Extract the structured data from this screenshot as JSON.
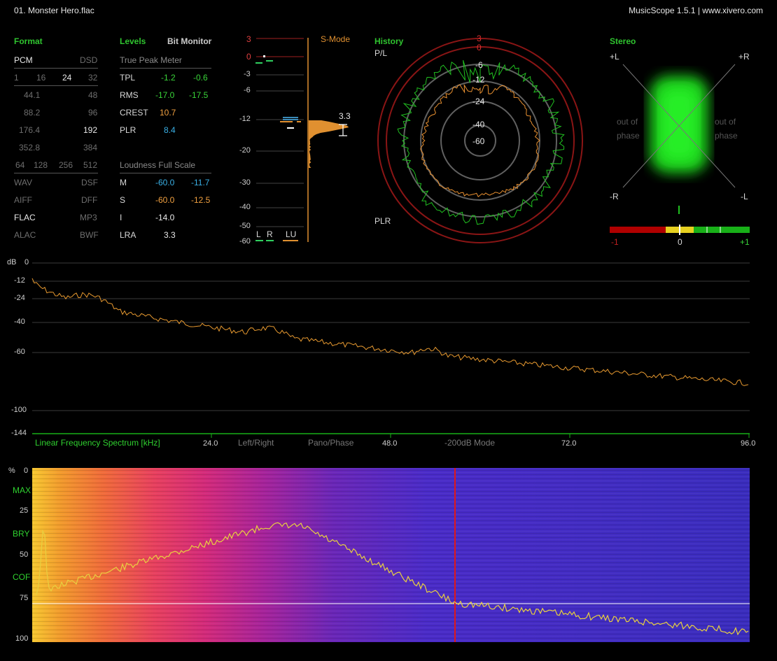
{
  "header": {
    "file": "01. Monster Hero.flac",
    "app": "MusicScope 1.5.1 | www.xivero.com"
  },
  "format": {
    "title": "Format",
    "rows": [
      {
        "l": "PCM",
        "r": "DSD"
      },
      {
        "cells": [
          "1",
          "16",
          "24",
          "32"
        ]
      },
      {
        "l": "44.1",
        "r": "48"
      },
      {
        "l": "88.2",
        "r": "96"
      },
      {
        "l": "176.4",
        "r": "192"
      },
      {
        "l": "352.8",
        "r": "384"
      },
      {
        "cells": [
          "64",
          "128",
          "256",
          "512"
        ]
      },
      {
        "l": "WAV",
        "r": "DSF"
      },
      {
        "l": "AIFF",
        "r": "DFF"
      },
      {
        "l": "FLAC",
        "r": "MP3"
      },
      {
        "l": "ALAC",
        "r": "BWF"
      }
    ]
  },
  "levels": {
    "title": "Levels",
    "bitmon": "Bit Monitor",
    "tpm": "True Peak Meter",
    "rows": [
      {
        "name": "TPL",
        "a": "-1.2",
        "b": "-0.6"
      },
      {
        "name": "RMS",
        "a": "-17.0",
        "b": "-17.5"
      },
      {
        "name": "CREST",
        "a": "10.7",
        "b": ""
      },
      {
        "name": "PLR",
        "a": "8.4",
        "b": ""
      }
    ],
    "lfs": "Loudness Full Scale",
    "lrows": [
      {
        "name": "M",
        "a": "-60.0",
        "b": "-11.7"
      },
      {
        "name": "S",
        "a": "-60.0",
        "b": "-12.5"
      },
      {
        "name": "I",
        "a": "-14.0",
        "b": ""
      },
      {
        "name": "LRA",
        "a": "3.3",
        "b": ""
      }
    ]
  },
  "meter": {
    "smode": "S-Mode",
    "ticks": [
      "3",
      "0",
      "-3",
      "-6",
      "-12",
      "-20",
      "-30",
      "-40",
      "-50",
      "-60"
    ],
    "lra_value": "3.3",
    "channels": [
      "L",
      "R",
      "LU"
    ]
  },
  "history": {
    "title": "History",
    "pl": "P/L",
    "plr": "PLR",
    "ticks": [
      "3",
      "0",
      "-6",
      "-12",
      "-24",
      "-40",
      "-60"
    ]
  },
  "stereo": {
    "title": "Stereo",
    "pl": "+L",
    "pr": "+R",
    "ml": "-R",
    "mr": "-L",
    "oop": "out of phase",
    "corr": [
      "-1",
      "0",
      "+1"
    ]
  },
  "spectrum": {
    "unit": "dB",
    "yticks": [
      "0",
      "-12",
      "-24",
      "-40",
      "-60",
      "-100",
      "-144"
    ],
    "caption": "Linear Frequency Spectrum [kHz]",
    "xticks": [
      "24.0",
      "48.0",
      "72.0",
      "96.0"
    ],
    "modes": [
      "Left/Right",
      "Pano/Phase",
      "-200dB Mode"
    ]
  },
  "spectrogram": {
    "unit": "%",
    "yticks": [
      "0",
      "25",
      "50",
      "75",
      "100"
    ],
    "markers": [
      "MAX",
      "BRY",
      "COF"
    ]
  },
  "colors": {
    "accent": "#2fc42f",
    "orange": "#f0a040",
    "blue": "#3ab0e6",
    "red": "#d02020"
  }
}
